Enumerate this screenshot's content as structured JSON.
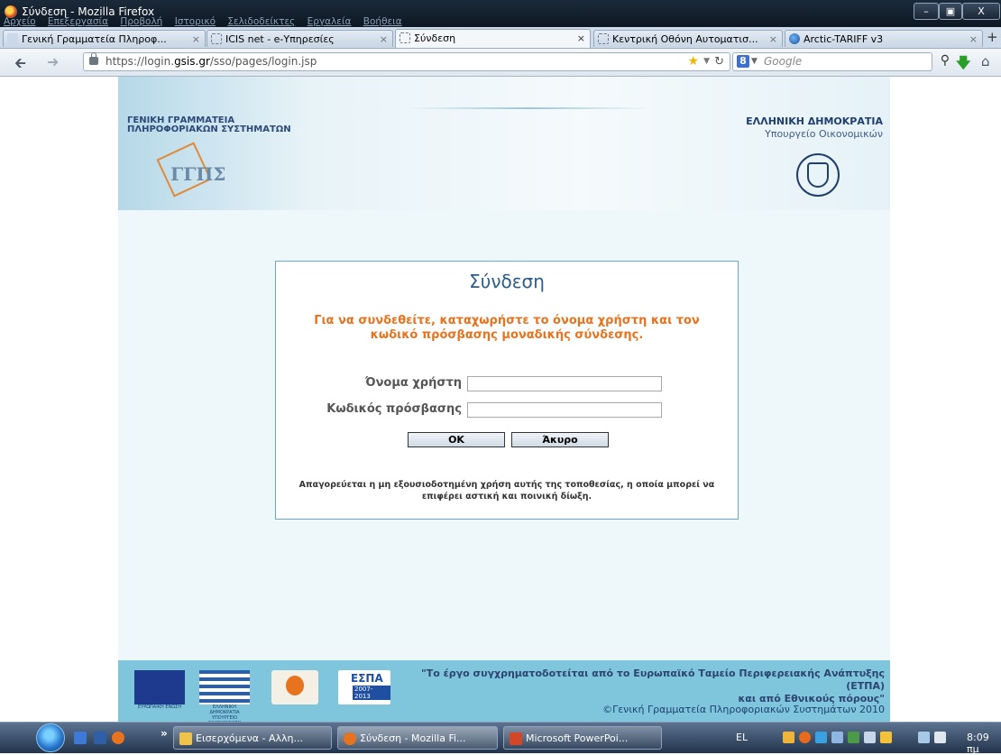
{
  "window": {
    "title": "Σύνδεση - Mozilla Firefox",
    "menus": [
      "Αρχείο",
      "Επεξεργασία",
      "Προβολή",
      "Ιστορικό",
      "Σελιδοδείκτες",
      "Εργαλεία",
      "Βοήθεια"
    ],
    "buttons": {
      "minimize": "–",
      "maximize": "▣",
      "close": "X"
    }
  },
  "tabs": [
    {
      "label": "Γενική Γραμματεία Πληροφ...",
      "close": "×"
    },
    {
      "label": "ICIS net - e-Υπηρεσίες",
      "close": "×"
    },
    {
      "label": "Σύνδεση",
      "close": "×",
      "active": true
    },
    {
      "label": "Κεντρική Οθόνη Αυτοματισ...",
      "close": "×"
    },
    {
      "label": "Arctic-TARIFF v3",
      "close": "×"
    }
  ],
  "tabs_new": "+",
  "navbar": {
    "url_prefix": "https://login.",
    "url_host": "gsis.gr",
    "url_path": "/sso/pages/login.jsp",
    "search_placeholder": "Google"
  },
  "banner": {
    "org_line1": "ΓΕΝΙΚΗ ΓΡΑΜΜΑΤΕΙΑ",
    "org_line2": "ΠΛΗΡΟΦΟΡΙΑΚΩΝ ΣΥΣΤΗΜΑΤΩΝ",
    "republic": "ΕΛΛΗΝΙΚΗ ΔΗΜΟΚΡΑΤΙΑ",
    "ministry": "Υπουργείο Οικονομικών",
    "logo_text": "ΓΓΠΣ"
  },
  "login": {
    "heading": "Σύνδεση",
    "instructions": "Για να συνδεθείτε, καταχωρήστε το όνομα χρήστη και τον κωδικό πρόσβασης μοναδικής σύνδεσης.",
    "username_label": "Όνομα χρήστη",
    "username_value": "",
    "password_label": "Κωδικός πρόσβασης",
    "password_value": "",
    "ok_button": "OK",
    "cancel_button": "Άκυρο",
    "warning": "Απαγορεύεται η μη εξουσιοδοτημένη χρήση αυτής της τοποθεσίας, η οποία μπορεί να επιφέρει αστική και ποινική δίωξη."
  },
  "footer": {
    "eu_caption": "ΕΥΡΩΠΑΪΚΗ ΕΝΩΣΗ",
    "gr_caption": "ΕΛΛΗΝΙΚΗ ΔΗΜΟΚΡΑΤΙΑ ΥΠΟΥΡΓΕΙΟ ΟΙΚΟΝΟΜΙΚΩΝ",
    "espa_label": "ΕΣΠΑ",
    "espa_years": "2007-2013",
    "funding_line1": "\"Το έργο συγχρηματοδοτείται από το Ευρωπαϊκό Ταμείο Περιφερειακής Ανάπτυξης (ΕΤΠΑ)",
    "funding_line2": "και από Εθνικούς πόρους\"",
    "copyright": "©Γενική Γραμματεία Πληροφοριακών Συστημάτων 2010"
  },
  "taskbar": {
    "items": [
      {
        "label": "Εισερχόμενα - Αλλη..."
      },
      {
        "label": "Σύνδεση - Mozilla Fi...",
        "active": true
      },
      {
        "label": "Microsoft PowerPoi..."
      }
    ],
    "language": "EL",
    "clock": "8:09 πμ",
    "more": "»"
  },
  "colors": {
    "accent_orange": "#e8731e",
    "heading_blue": "#2b5c8a",
    "footer_blue": "#7fc6dc"
  }
}
